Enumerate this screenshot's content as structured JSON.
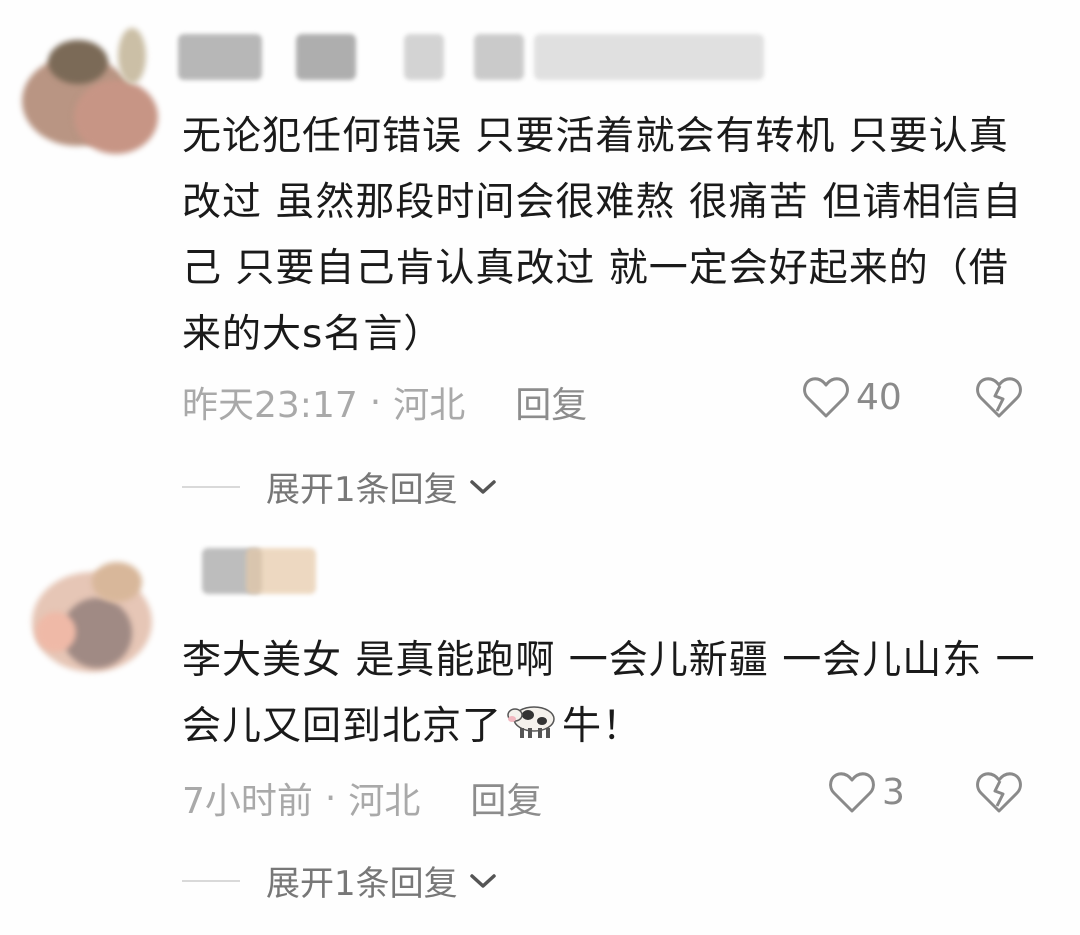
{
  "comments": [
    {
      "text": "无论犯任何错误 只要活着就会有转机 只要认真改过 虽然那段时间会很难熬 很痛苦 但请相信自己 只要自己肯认真改过 就一定会好起来的（借来的大s名言）",
      "time": "昨天23:17",
      "separator": "·",
      "location": "河北",
      "reply_label": "回复",
      "likes": "40",
      "expand_label": "展开1条回复"
    },
    {
      "text_before": "李大美女 是真能跑啊 一会儿新疆 一会儿山东 一会儿又回到北京了",
      "text_after": "牛！",
      "emoji_icon": "cow-icon",
      "time": "7小时前",
      "separator": "·",
      "location": "河北",
      "reply_label": "回复",
      "likes": "3",
      "expand_label": "展开1条回复"
    }
  ],
  "colors": {
    "text": "#1a1a1a",
    "meta": "#a9a9a9",
    "icon": "#8a8a8a",
    "background": "#fefefe"
  }
}
